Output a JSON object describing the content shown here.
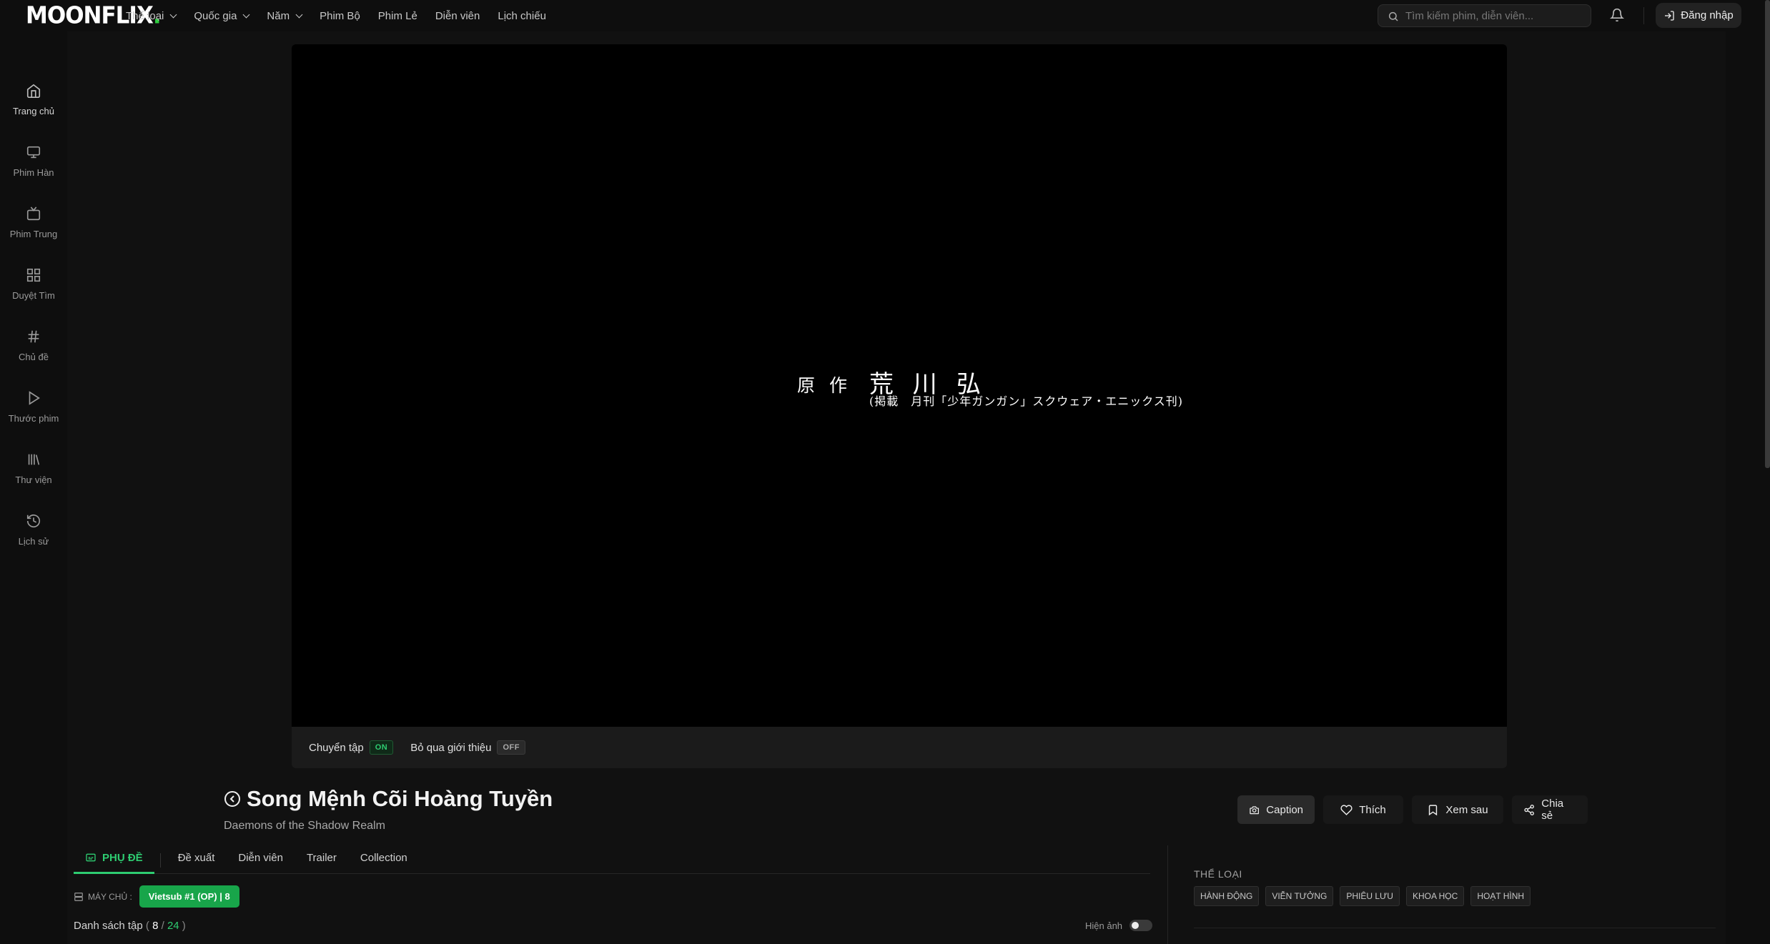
{
  "brand": {
    "logo_text": "MOONFLIX",
    "logo_dot": ".",
    "accent": "#2ecc71"
  },
  "nav": {
    "items": [
      "Thể loại",
      "Quốc gia",
      "Năm",
      "Phim Bộ",
      "Phim Lẻ",
      "Diễn viên",
      "Lịch chiếu"
    ],
    "dropdown_flags": [
      true,
      true,
      true,
      false,
      false,
      false,
      false
    ]
  },
  "search": {
    "placeholder": "Tìm kiếm phim, diễn viên..."
  },
  "login": {
    "label": "Đăng nhập"
  },
  "sidebar": {
    "items": [
      {
        "label": "Trang chủ",
        "icon": "home-icon"
      },
      {
        "label": "Phim Hàn",
        "icon": "monitor-icon"
      },
      {
        "label": "Phim Trung",
        "icon": "tv-icon"
      },
      {
        "label": "Duyệt Tìm",
        "icon": "grid-icon"
      },
      {
        "label": "Chủ đề",
        "icon": "hash-icon"
      },
      {
        "label": "Thước phim",
        "icon": "play-icon"
      },
      {
        "label": "Thư viện",
        "icon": "library-icon"
      },
      {
        "label": "Lịch sử",
        "icon": "history-icon"
      }
    ]
  },
  "player": {
    "frame_text": {
      "line1": "原 作",
      "line2": "荒 川",
      "line3": "弘",
      "line4": "(掲載　月刊「少年ガンガン」スクウェア・エニックス刊)"
    },
    "controls": {
      "autonext_label": "Chuyển tập",
      "autonext_state": "ON",
      "skipintro_label": "Bỏ qua giới thiệu",
      "skipintro_state": "OFF"
    }
  },
  "movie": {
    "title": "Song Mệnh Cõi Hoàng Tuyền",
    "subtitle": "Daemons of the Shadow Realm"
  },
  "actions": {
    "caption": "Caption",
    "like": "Thích",
    "later": "Xem sau",
    "share": "Chia sẻ"
  },
  "tabs": {
    "items": [
      "PHỤ ĐỀ",
      "Đề xuất",
      "Diễn viên",
      "Trailer",
      "Collection"
    ],
    "active": 0
  },
  "server": {
    "label": "MÁY CHỦ :",
    "button": "Vietsub #1 (OP) | 8"
  },
  "episodes": {
    "label": "Danh sách tập",
    "open": "(",
    "current": "8",
    "slash": "/",
    "total": "24",
    "close": ")",
    "toggle_label": "Hiện ảnh",
    "toggle_on": false
  },
  "genres": {
    "heading": "THỂ LOẠI",
    "items": [
      "HÀNH ĐỘNG",
      "VIỄN TƯỞNG",
      "PHIÊU LƯU",
      "KHOA HỌC",
      "HOẠT HÌNH"
    ]
  }
}
